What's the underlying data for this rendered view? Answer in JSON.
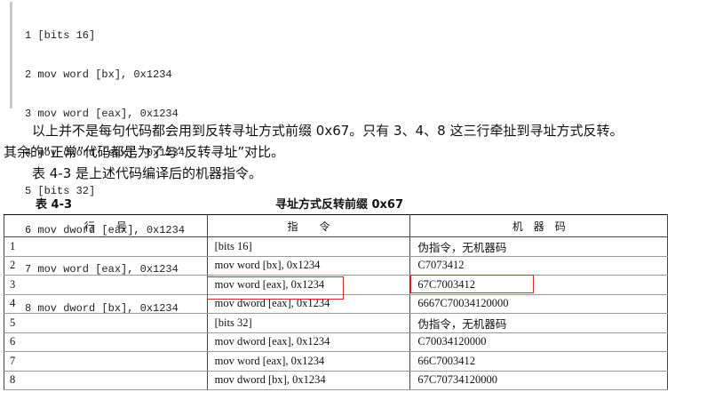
{
  "code": {
    "lines": [
      "1 [bits 16]",
      "2 mov word [bx], 0x1234",
      "3 mov word [eax], 0x1234",
      "4 mov dword [eax], 0x1234",
      "5 [bits 32]",
      "6 mov dword [eax], 0x1234",
      "7 mov word [eax], 0x1234",
      "8 mov dword [bx], 0x1234"
    ]
  },
  "paragraphs": [
    "以上并不是每句代码都会用到反转寻址方式前缀 0x67。只有 3、4、8 这三行牵扯到寻址方式反转。",
    "其余的“正常”代码都是为了与“反转寻址”对比。",
    "表 4-3 是上述代码编译后的机器指令。"
  ],
  "table": {
    "number": "表 4-3",
    "title": "寻址方式反转前缀 0x67",
    "headers": [
      "行　　号",
      "指　　令",
      "机　器　码"
    ],
    "rows": [
      [
        "1",
        "[bits 16]",
        "伪指令，无机器码"
      ],
      [
        "2",
        "mov word [bx], 0x1234",
        "C7073412"
      ],
      [
        "3",
        "mov word [eax], 0x1234",
        "67C7003412"
      ],
      [
        "4",
        "mov dword [eax], 0x1234",
        "6667C70034120000"
      ],
      [
        "5",
        "[bits 32]",
        "伪指令，无机器码"
      ],
      [
        "6",
        "mov dword [eax], 0x1234",
        "C70034120000"
      ],
      [
        "7",
        "mov word [eax], 0x1234",
        "66C7003412"
      ],
      [
        "8",
        "mov dword [bx], 0x1234",
        "67C70734120000"
      ]
    ]
  },
  "highlight_color": "#d62a2a"
}
